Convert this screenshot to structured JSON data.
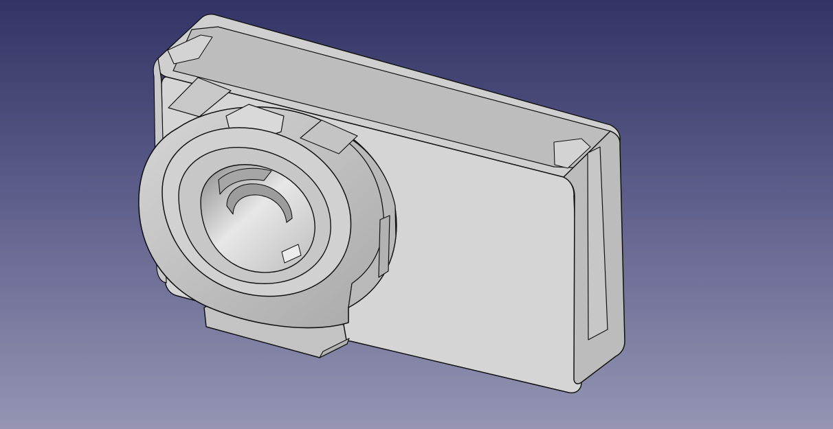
{
  "viewport": {
    "kind": "3d-cad-view",
    "background": {
      "top_color": "#333366",
      "bottom_color": "#9595b3"
    },
    "model": {
      "body_color": "#cfcfcf",
      "edge_color": "#111111"
    }
  }
}
